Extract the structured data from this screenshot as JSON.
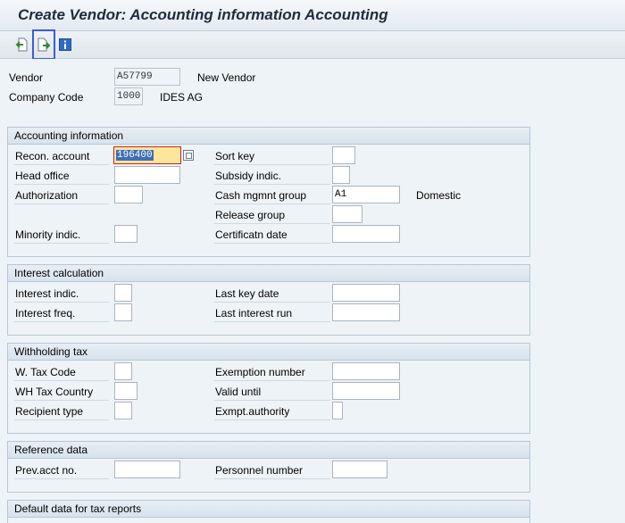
{
  "window": {
    "title": "Create Vendor: Accounting information Accounting"
  },
  "toolbar": {
    "buttons": [
      {
        "name": "previous-screen",
        "icon": "previous-screen-icon"
      },
      {
        "name": "next-screen",
        "icon": "next-screen-icon"
      },
      {
        "name": "info",
        "icon": "info-icon"
      }
    ]
  },
  "header": {
    "vendor_label": "Vendor",
    "vendor_value": "A57799",
    "vendor_desc": "New Vendor",
    "company_label": "Company Code",
    "company_value": "1000",
    "company_desc": "IDES AG"
  },
  "accounting": {
    "title": "Accounting information",
    "recon_label": "Recon. account",
    "recon_value": "196400",
    "head_office_label": "Head office",
    "head_office_value": "",
    "authorization_label": "Authorization",
    "authorization_value": "",
    "minority_label": "Minority indic.",
    "minority_value": "",
    "sort_key_label": "Sort key",
    "sort_key_value": "",
    "subsidy_label": "Subsidy indic.",
    "subsidy_value": "",
    "cash_group_label": "Cash mgmnt group",
    "cash_group_value": "A1",
    "cash_group_desc": "Domestic",
    "release_label": "Release group",
    "release_value": "",
    "cert_date_label": "Certificatn date",
    "cert_date_value": ""
  },
  "interest": {
    "title": "Interest calculation",
    "indic_label": "Interest indic.",
    "indic_value": "",
    "freq_label": "Interest freq.",
    "freq_value": "",
    "last_key_label": "Last key date",
    "last_key_value": "",
    "last_run_label": "Last interest run",
    "last_run_value": ""
  },
  "withholding": {
    "title": "Withholding tax",
    "wtax_code_label": "W. Tax Code",
    "wtax_code_value": "",
    "wh_country_label": "WH Tax Country",
    "wh_country_value": "",
    "recipient_label": "Recipient type",
    "recipient_value": "",
    "exemption_label": "Exemption number",
    "exemption_value": "",
    "valid_label": "Valid  until",
    "valid_value": "",
    "exmpt_auth_label": "Exmpt.authority",
    "exmpt_auth_value": ""
  },
  "reference": {
    "title": "Reference data",
    "prev_acct_label": "Prev.acct no.",
    "prev_acct_value": "",
    "personnel_label": "Personnel number",
    "personnel_value": ""
  },
  "tax_reports": {
    "title": "Default data for tax reports"
  }
}
